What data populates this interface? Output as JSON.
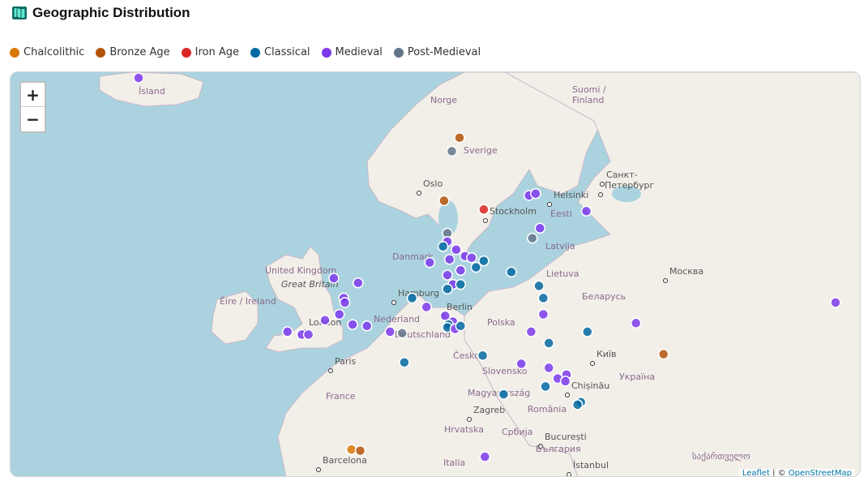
{
  "header": {
    "title": "Geographic Distribution",
    "icon": "map-icon"
  },
  "legend": [
    {
      "label": "Chalcolithic",
      "color": "#d97706"
    },
    {
      "label": "Bronze Age",
      "color": "#b45309"
    },
    {
      "label": "Iron Age",
      "color": "#dc2626"
    },
    {
      "label": "Classical",
      "color": "#0369a1"
    },
    {
      "label": "Medieval",
      "color": "#7c3aed"
    },
    {
      "label": "Post-Medieval",
      "color": "#64748b"
    }
  ],
  "map": {
    "zoom_in": "+",
    "zoom_out": "−",
    "attribution_leaflet": "Leaflet",
    "attribution_sep": " | © ",
    "attribution_osm": "OpenStreetMap",
    "labels": [
      {
        "text": "Ísland",
        "kind": "country"
      },
      {
        "text": "Norge",
        "kind": "country"
      },
      {
        "text": "Suomi /",
        "kind": "country"
      },
      {
        "text": "Finland",
        "kind": "country"
      },
      {
        "text": "Sverige",
        "kind": "country"
      },
      {
        "text": "Oslo",
        "kind": "city"
      },
      {
        "text": "Stockholm",
        "kind": "city"
      },
      {
        "text": "Helsinki",
        "kind": "city"
      },
      {
        "text": "Санкт-",
        "kind": "city"
      },
      {
        "text": "Петербург",
        "kind": "city"
      },
      {
        "text": "Eesti",
        "kind": "country"
      },
      {
        "text": "Latvija",
        "kind": "country"
      },
      {
        "text": "Lietuva",
        "kind": "country"
      },
      {
        "text": "Москва",
        "kind": "city"
      },
      {
        "text": "United Kingdom",
        "kind": "country"
      },
      {
        "text": "Great Britain",
        "kind": "island"
      },
      {
        "text": "Éire / Ireland",
        "kind": "country"
      },
      {
        "text": "Danmark",
        "kind": "country"
      },
      {
        "text": "Hamburg",
        "kind": "city"
      },
      {
        "text": "Berlin",
        "kind": "city"
      },
      {
        "text": "Nederland",
        "kind": "country"
      },
      {
        "text": "London",
        "kind": "city"
      },
      {
        "text": "Deutschland",
        "kind": "country"
      },
      {
        "text": "Polska",
        "kind": "country"
      },
      {
        "text": "Беларусь",
        "kind": "country"
      },
      {
        "text": "Paris",
        "kind": "city"
      },
      {
        "text": "Česko",
        "kind": "country"
      },
      {
        "text": "Київ",
        "kind": "city"
      },
      {
        "text": "Slovensko",
        "kind": "country"
      },
      {
        "text": "France",
        "kind": "country"
      },
      {
        "text": "Magyarország",
        "kind": "country"
      },
      {
        "text": "Chișinău",
        "kind": "city"
      },
      {
        "text": "Україна",
        "kind": "country"
      },
      {
        "text": "Zagreb",
        "kind": "city"
      },
      {
        "text": "România",
        "kind": "country"
      },
      {
        "text": "Hrvatska",
        "kind": "country"
      },
      {
        "text": "Србија",
        "kind": "country"
      },
      {
        "text": "București",
        "kind": "city"
      },
      {
        "text": "България",
        "kind": "country"
      },
      {
        "text": "Barcelona",
        "kind": "city"
      },
      {
        "text": "Italia",
        "kind": "country"
      },
      {
        "text": "İstanbul",
        "kind": "city"
      },
      {
        "text": "საქართველო",
        "kind": "country"
      }
    ],
    "sites": [
      {
        "period": "Medieval",
        "lat": 65.6,
        "lon": -18.1
      },
      {
        "period": "Bronze Age",
        "lat": 62.7,
        "lon": 11.0
      },
      {
        "period": "Post-Medieval",
        "lat": 62.0,
        "lon": 10.3
      },
      {
        "period": "Bronze Age",
        "lat": 59.3,
        "lon": 9.6
      },
      {
        "period": "Iron Age",
        "lat": 58.8,
        "lon": 13.2
      },
      {
        "period": "Medieval",
        "lat": 59.6,
        "lon": 17.3
      },
      {
        "period": "Medieval",
        "lat": 59.7,
        "lon": 17.9
      },
      {
        "period": "Medieval",
        "lat": 58.7,
        "lon": 22.5
      },
      {
        "period": "Medieval",
        "lat": 57.7,
        "lon": 18.3
      },
      {
        "period": "Post-Medieval",
        "lat": 57.1,
        "lon": 17.6
      },
      {
        "period": "Post-Medieval",
        "lat": 57.4,
        "lon": 9.9
      },
      {
        "period": "Medieval",
        "lat": 56.9,
        "lon": 9.9
      },
      {
        "period": "Classical",
        "lat": 56.6,
        "lon": 9.5
      },
      {
        "period": "Medieval",
        "lat": 56.4,
        "lon": 10.7
      },
      {
        "period": "Medieval",
        "lat": 56.0,
        "lon": 11.5
      },
      {
        "period": "Medieval",
        "lat": 55.9,
        "lon": 12.1
      },
      {
        "period": "Medieval",
        "lat": 55.8,
        "lon": 10.1
      },
      {
        "period": "Classical",
        "lat": 55.7,
        "lon": 13.2
      },
      {
        "period": "Classical",
        "lat": 55.3,
        "lon": 12.5
      },
      {
        "period": "Medieval",
        "lat": 55.6,
        "lon": 8.3
      },
      {
        "period": "Medieval",
        "lat": 55.1,
        "lon": 11.1
      },
      {
        "period": "Classical",
        "lat": 55.0,
        "lon": 15.7
      },
      {
        "period": "Medieval",
        "lat": 54.8,
        "lon": 9.9
      },
      {
        "period": "Medieval",
        "lat": 54.2,
        "lon": 10.4
      },
      {
        "period": "Classical",
        "lat": 54.2,
        "lon": 11.1
      },
      {
        "period": "Classical",
        "lat": 53.9,
        "lon": 9.9
      },
      {
        "period": "Classical",
        "lat": 54.1,
        "lon": 18.2
      },
      {
        "period": "Medieval",
        "lat": 54.3,
        "lon": 1.8
      },
      {
        "period": "Medieval",
        "lat": 54.6,
        "lon": -0.4
      },
      {
        "period": "Medieval",
        "lat": 53.3,
        "lon": 0.5
      },
      {
        "period": "Medieval",
        "lat": 53.0,
        "lon": 0.6
      },
      {
        "period": "Medieval",
        "lat": 52.2,
        "lon": 0.1
      },
      {
        "period": "Medieval",
        "lat": 51.8,
        "lon": -1.2
      },
      {
        "period": "Medieval",
        "lat": 51.5,
        "lon": 1.3
      },
      {
        "period": "Medieval",
        "lat": 51.4,
        "lon": 2.6
      },
      {
        "period": "Medieval",
        "lat": 51.0,
        "lon": -4.6
      },
      {
        "period": "Medieval",
        "lat": 50.8,
        "lon": -3.3
      },
      {
        "period": "Medieval",
        "lat": 50.8,
        "lon": -2.7
      },
      {
        "period": "Classical",
        "lat": 53.3,
        "lon": 6.7
      },
      {
        "period": "Medieval",
        "lat": 52.7,
        "lon": 8.0
      },
      {
        "period": "Post-Medieval",
        "lat": 50.9,
        "lon": 5.8
      },
      {
        "period": "Medieval",
        "lat": 51.0,
        "lon": 4.7
      },
      {
        "period": "Medieval",
        "lat": 52.1,
        "lon": 9.7
      },
      {
        "period": "Medieval",
        "lat": 51.7,
        "lon": 10.4
      },
      {
        "period": "Classical",
        "lat": 51.5,
        "lon": 10.0
      },
      {
        "period": "Classical",
        "lat": 51.3,
        "lon": 9.9
      },
      {
        "period": "Medieval",
        "lat": 51.2,
        "lon": 10.6
      },
      {
        "period": "Classical",
        "lat": 51.4,
        "lon": 11.1
      },
      {
        "period": "Medieval",
        "lat": 52.2,
        "lon": 18.6
      },
      {
        "period": "Classical",
        "lat": 53.3,
        "lon": 18.6
      },
      {
        "period": "Medieval",
        "lat": 51.0,
        "lon": 17.5
      },
      {
        "period": "Classical",
        "lat": 51.0,
        "lon": 22.6
      },
      {
        "period": "Classical",
        "lat": 50.2,
        "lon": 19.1
      },
      {
        "period": "Classical",
        "lat": 49.3,
        "lon": 13.1
      },
      {
        "period": "Classical",
        "lat": 48.8,
        "lon": 6.0
      },
      {
        "period": "Medieval",
        "lat": 48.7,
        "lon": 16.6
      },
      {
        "period": "Medieval",
        "lat": 48.4,
        "lon": 19.1
      },
      {
        "period": "Medieval",
        "lat": 47.9,
        "lon": 20.7
      },
      {
        "period": "Medieval",
        "lat": 47.6,
        "lon": 19.9
      },
      {
        "period": "Medieval",
        "lat": 47.4,
        "lon": 20.6
      },
      {
        "period": "Classical",
        "lat": 47.0,
        "lon": 18.8
      },
      {
        "period": "Classical",
        "lat": 46.4,
        "lon": 15.0
      },
      {
        "period": "Classical",
        "lat": 45.8,
        "lon": 22.0
      },
      {
        "period": "Classical",
        "lat": 45.6,
        "lon": 21.7
      },
      {
        "period": "Medieval",
        "lat": 51.6,
        "lon": 27.0
      },
      {
        "period": "Bronze Age",
        "lat": 49.4,
        "lon": 29.5
      },
      {
        "period": "Medieval",
        "lat": 53.0,
        "lon": 45.1
      },
      {
        "period": "Chalcolithic",
        "lat": 42.0,
        "lon": 1.2
      },
      {
        "period": "Bronze Age",
        "lat": 41.9,
        "lon": 2.0
      },
      {
        "period": "Medieval",
        "lat": 41.4,
        "lon": 13.3
      }
    ]
  }
}
